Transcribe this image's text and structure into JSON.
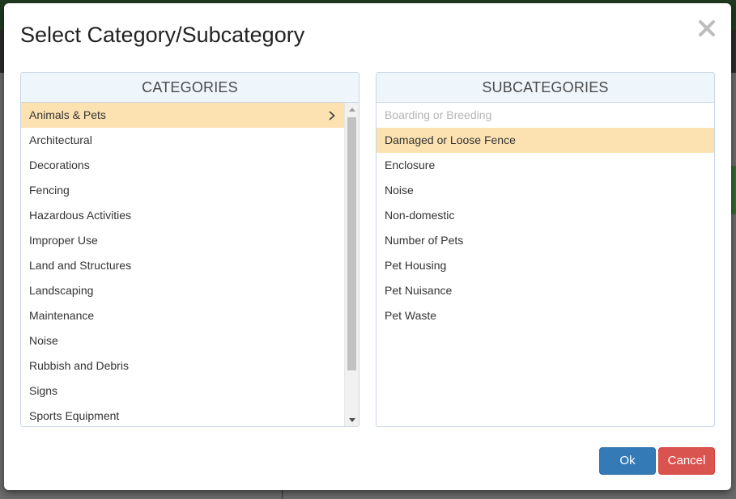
{
  "modal": {
    "title": "Select Category/Subcategory",
    "close_symbol": "✕"
  },
  "categories": {
    "header": "CATEGORIES",
    "selected_index": 0,
    "scroll_position_fraction": 0.0,
    "items": [
      {
        "label": "Animals & Pets"
      },
      {
        "label": "Architectural"
      },
      {
        "label": "Decorations"
      },
      {
        "label": "Fencing"
      },
      {
        "label": "Hazardous Activities"
      },
      {
        "label": "Improper Use"
      },
      {
        "label": "Land and Structures"
      },
      {
        "label": "Landscaping"
      },
      {
        "label": "Maintenance"
      },
      {
        "label": "Noise"
      },
      {
        "label": "Rubbish and Debris"
      },
      {
        "label": "Signs"
      },
      {
        "label": "Sports Equipment"
      }
    ]
  },
  "subcategories": {
    "header": "SUBCATEGORIES",
    "selected_index": 1,
    "items": [
      {
        "label": "Boarding or Breeding",
        "disabled": true
      },
      {
        "label": "Damaged or Loose Fence"
      },
      {
        "label": "Enclosure"
      },
      {
        "label": "Noise"
      },
      {
        "label": "Non-domestic"
      },
      {
        "label": "Number of Pets"
      },
      {
        "label": "Pet Housing"
      },
      {
        "label": "Pet Nuisance"
      },
      {
        "label": "Pet Waste"
      }
    ]
  },
  "buttons": {
    "ok_label": "Ok",
    "cancel_label": "Cancel"
  },
  "colors": {
    "selected_row": "#fde2b1",
    "header_bg": "#eef6fc",
    "ok": "#337ab7",
    "cancel": "#d9534f"
  }
}
